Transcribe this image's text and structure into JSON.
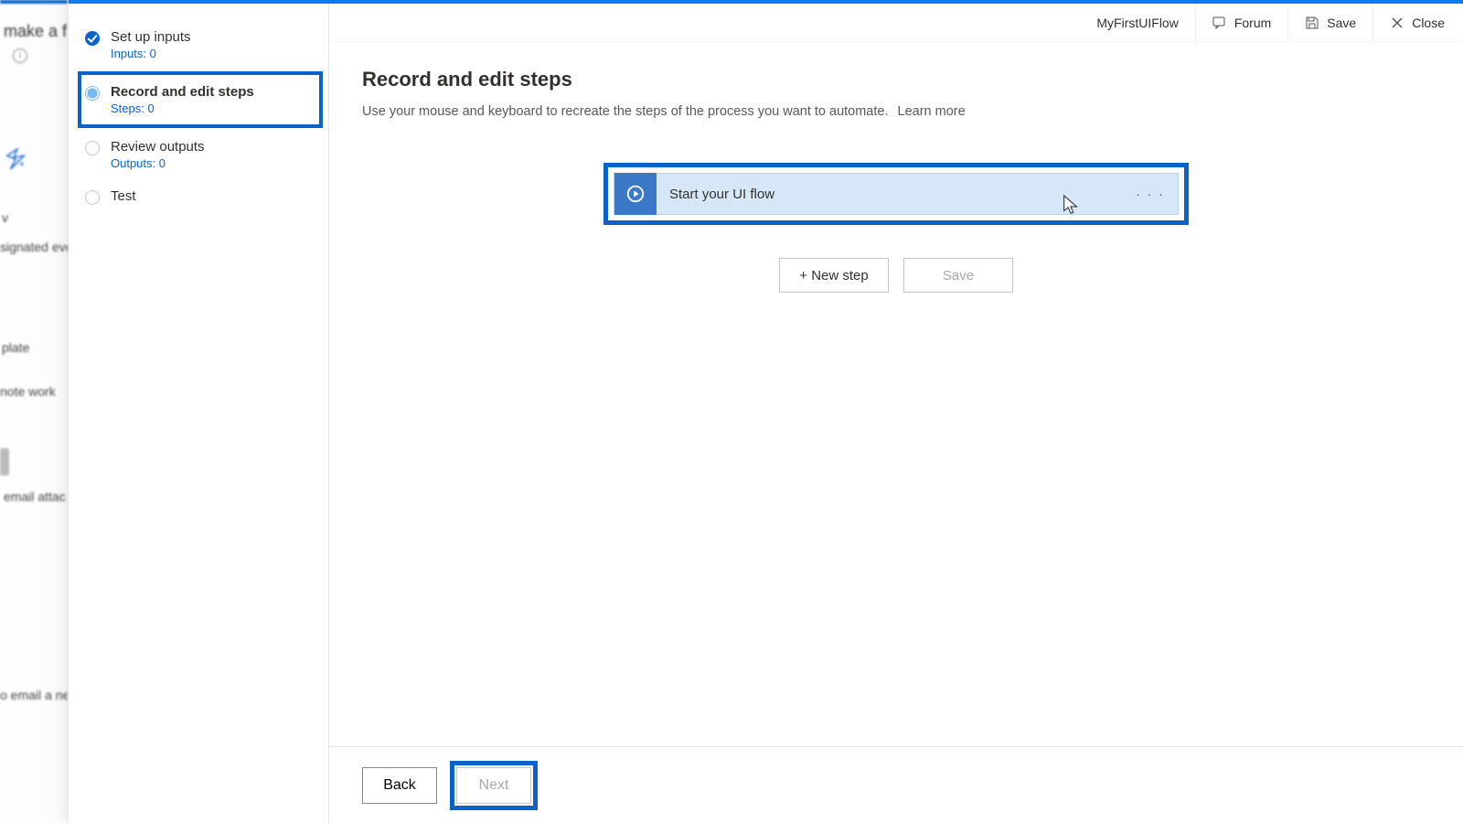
{
  "bg": {
    "heading": "make a fl",
    "row1": "v",
    "row2": "signated even",
    "row3": "plate",
    "row4": "note work",
    "row5": "email attac",
    "row6": "o email a ne"
  },
  "toolbar": {
    "flow_name": "MyFirstUIFlow",
    "forum": "Forum",
    "save": "Save",
    "close": "Close"
  },
  "steps": {
    "s1": {
      "title": "Set up inputs",
      "sub": "Inputs: 0"
    },
    "s2": {
      "title": "Record and edit steps",
      "sub": "Steps: 0"
    },
    "s3": {
      "title": "Review outputs",
      "sub": "Outputs: 0"
    },
    "s4": {
      "title": "Test"
    }
  },
  "main": {
    "title": "Record and edit steps",
    "desc": "Use your mouse and keyboard to recreate the steps of the process you want to automate.",
    "learn_more": "Learn more",
    "card_title": "Start your UI flow",
    "card_menu": "· · ·",
    "new_step": "+ New step",
    "save": "Save"
  },
  "footer": {
    "back": "Back",
    "next": "Next"
  }
}
